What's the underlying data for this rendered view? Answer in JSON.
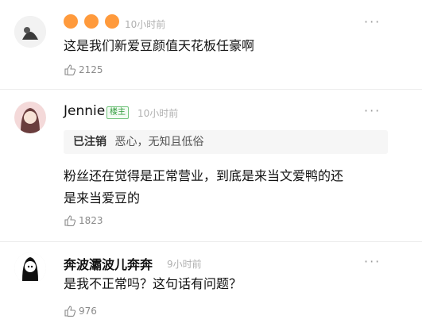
{
  "comments": [
    {
      "name": "😘😘😘",
      "time": "10小时前",
      "more": "···",
      "text": "这是我们新爱豆颜值天花板任豪啊",
      "likes": "2125"
    },
    {
      "name": "Jennie",
      "badge": "楼主",
      "time": "10小时前",
      "more": "···",
      "quote_name": "已注销",
      "quote_text": "恶心，无知且低俗",
      "text_line1": "粉丝还在觉得是正常营业，到底是来当文爱鸭的还",
      "text_line2": "是来当爱豆的",
      "likes": "1823"
    },
    {
      "name": "奔波灞波儿奔奔",
      "time": "9小时前",
      "more": "···",
      "text": "是我不正常吗？这句话有问题？",
      "likes": "976"
    }
  ]
}
